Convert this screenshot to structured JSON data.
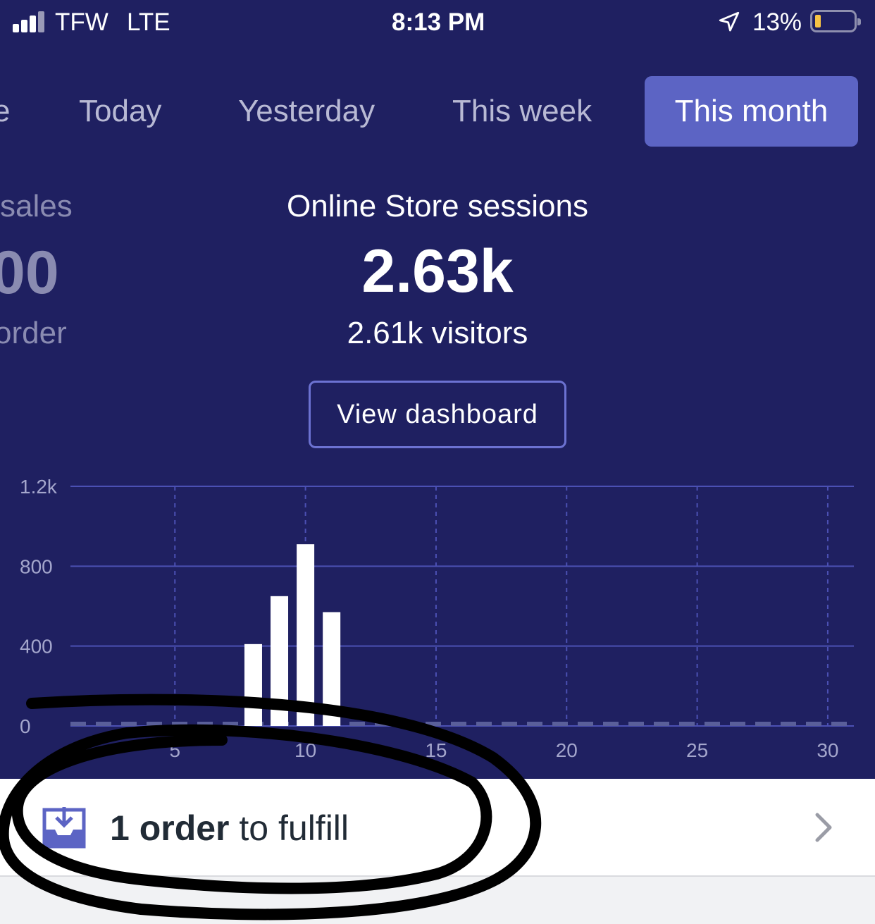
{
  "status_bar": {
    "carrier": "TFW",
    "network": "LTE",
    "time": "8:13 PM",
    "battery_percent": "13%"
  },
  "tabs": [
    {
      "label": "e",
      "active": false
    },
    {
      "label": "Today",
      "active": false
    },
    {
      "label": "Yesterday",
      "active": false
    },
    {
      "label": "This week",
      "active": false
    },
    {
      "label": "This month",
      "active": true
    }
  ],
  "left_panel": {
    "title": "sales",
    "value": "00",
    "subtitle": "order"
  },
  "sessions": {
    "title": "Online Store sessions",
    "value": "2.63k",
    "subtitle": "2.61k visitors"
  },
  "view_dashboard_label": "View dashboard",
  "chart_data": {
    "type": "bar",
    "y_ticks": [
      "0",
      "400",
      "800",
      "1.2k"
    ],
    "x_ticks": [
      "5",
      "10",
      "15",
      "20",
      "25",
      "30"
    ],
    "x": [
      8,
      9,
      10,
      11
    ],
    "values": [
      410,
      650,
      910,
      570
    ],
    "ylim": [
      0,
      1200
    ],
    "xlim": [
      1,
      31
    ],
    "grid": true,
    "colors": {
      "bar": "#ffffff",
      "grid": "#4b50b3",
      "axis_text": "#a4a6cc"
    }
  },
  "fulfill": {
    "count": "1 order",
    "suffix": " to fulfill"
  },
  "colors": {
    "background": "#1f2061",
    "active_tab": "#5c64c4",
    "button_border": "#6c72d2",
    "accent_icon": "#5c64c4"
  },
  "icons": {
    "location": "location-arrow-icon",
    "fulfill": "inbox-download-icon",
    "chevron": "chevron-right-icon"
  }
}
